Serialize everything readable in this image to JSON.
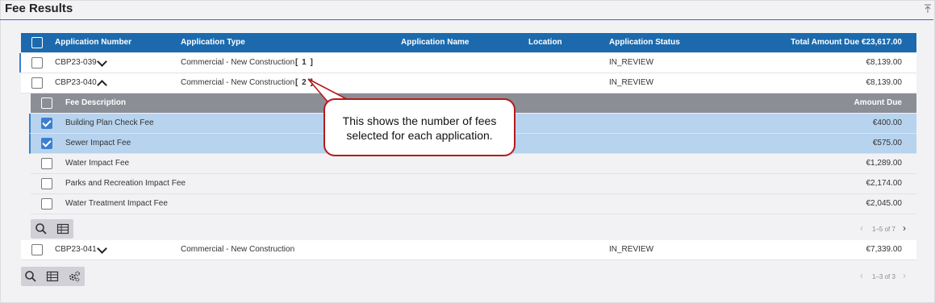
{
  "panel": {
    "title": "Fee Results"
  },
  "table": {
    "headers": {
      "app_number": "Application Number",
      "app_type": "Application Type",
      "app_name": "Application Name",
      "location": "Location",
      "status": "Application Status",
      "total": "Total Amount Due €23,617.00"
    },
    "rows": [
      {
        "number": "CBP23-039",
        "type": "Commercial - New Construction",
        "count": "[ 1 ]",
        "status": "IN_REVIEW",
        "amount": "€8,139.00",
        "expanded": false
      },
      {
        "number": "CBP23-040",
        "type": "Commercial - New Construction",
        "count": "[ 2 ]",
        "status": "IN_REVIEW",
        "amount": "€8,139.00",
        "expanded": true
      },
      {
        "number": "CBP23-041",
        "type": "Commercial - New Construction",
        "status": "IN_REVIEW",
        "amount": "€7,339.00",
        "expanded": false
      }
    ]
  },
  "fees": {
    "headers": {
      "description": "Fee Description",
      "amount": "Amount Due"
    },
    "rows": [
      {
        "description": "Building Plan Check Fee",
        "amount": "€400.00",
        "checked": true
      },
      {
        "description": "Sewer Impact Fee",
        "amount": "€575.00",
        "checked": true
      },
      {
        "description": "Water Impact Fee",
        "amount": "€1,289.00",
        "checked": false
      },
      {
        "description": "Parks and Recreation Impact Fee",
        "amount": "€2,174.00",
        "checked": false
      },
      {
        "description": "Water Treatment Impact Fee",
        "amount": "€2,045.00",
        "checked": false
      }
    ],
    "pager": "1–5 of 7"
  },
  "outer_pager": "1–3 of 3",
  "callout": {
    "text": "This shows the number of fees selected for each application."
  },
  "colors": {
    "header_blue": "#1c6aad",
    "sub_header_gray": "#8c8e96",
    "selected_row": "#b7d3ee",
    "callout_border": "#b31b1b"
  },
  "icons": [
    "collapse-top-icon",
    "chevron-down-icon",
    "chevron-up-icon",
    "search-icon",
    "table-icon",
    "settings-icon",
    "prev-page-icon",
    "next-page-icon"
  ]
}
